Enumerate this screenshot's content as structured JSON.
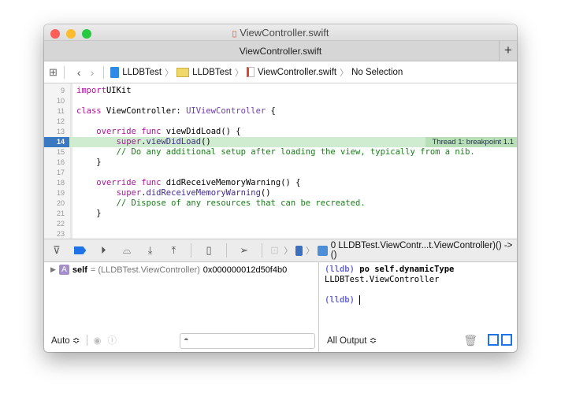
{
  "window": {
    "title": "ViewController.swift"
  },
  "tab": {
    "label": "ViewController.swift",
    "add": "+"
  },
  "jumpbar": {
    "items": [
      "LLDBTest",
      "LLDBTest",
      "ViewController.swift",
      "No Selection"
    ]
  },
  "editor": {
    "lines": [
      {
        "n": "9",
        "tokens": [
          [
            "kw",
            "import"
          ],
          [
            "",
            "UIKit"
          ]
        ]
      },
      {
        "n": "10",
        "tokens": []
      },
      {
        "n": "11",
        "tokens": [
          [
            "kw",
            "class"
          ],
          [
            "",
            " ViewController: "
          ],
          [
            "ty",
            "UIViewController"
          ],
          [
            "",
            " {"
          ]
        ]
      },
      {
        "n": "12",
        "tokens": []
      },
      {
        "n": "13",
        "tokens": [
          [
            "",
            "    "
          ],
          [
            "kw",
            "override func"
          ],
          [
            "",
            " viewDidLoad() {"
          ]
        ]
      },
      {
        "n": "14",
        "tokens": [
          [
            "",
            "        "
          ],
          [
            "kw",
            "super"
          ],
          [
            "",
            "."
          ],
          [
            "fn",
            "viewDidLoad"
          ],
          [
            "",
            "()"
          ]
        ],
        "highlight": true
      },
      {
        "n": "15",
        "tokens": [
          [
            "cm",
            "        // Do any additional setup after loading the view, typically from a nib."
          ]
        ]
      },
      {
        "n": "16",
        "tokens": [
          [
            "",
            "    }"
          ]
        ]
      },
      {
        "n": "17",
        "tokens": []
      },
      {
        "n": "18",
        "tokens": [
          [
            "",
            "    "
          ],
          [
            "kw",
            "override func"
          ],
          [
            "",
            " didReceiveMemoryWarning() {"
          ]
        ]
      },
      {
        "n": "19",
        "tokens": [
          [
            "",
            "        "
          ],
          [
            "kw",
            "super"
          ],
          [
            "",
            "."
          ],
          [
            "fn",
            "didReceiveMemoryWarning"
          ],
          [
            "",
            "()"
          ]
        ]
      },
      {
        "n": "20",
        "tokens": [
          [
            "cm",
            "        // Dispose of any resources that can be recreated."
          ]
        ]
      },
      {
        "n": "21",
        "tokens": [
          [
            "",
            "    }"
          ]
        ]
      },
      {
        "n": "22",
        "tokens": []
      },
      {
        "n": "23",
        "tokens": []
      }
    ],
    "breakpoint_label": "Thread 1: breakpoint 1.1"
  },
  "debugbar": {
    "frame": "0 LLDBTest.ViewContr...t.ViewController)() -> ()"
  },
  "variables": {
    "name": "self",
    "type": "= (LLDBTest.ViewController)",
    "value": "0x000000012d50f4b0",
    "badge": "A"
  },
  "left_footer": {
    "scope": "Auto ≎"
  },
  "console": {
    "prompt": "(lldb)",
    "command": "po self.dynamicType",
    "output": "LLDBTest.ViewController"
  },
  "right_footer": {
    "output_filter": "All Output ≎"
  },
  "colors": {
    "accent": "#1e73e8",
    "highlight": "#d0ecd0",
    "keyword": "#b0129c",
    "comment": "#167e16"
  }
}
